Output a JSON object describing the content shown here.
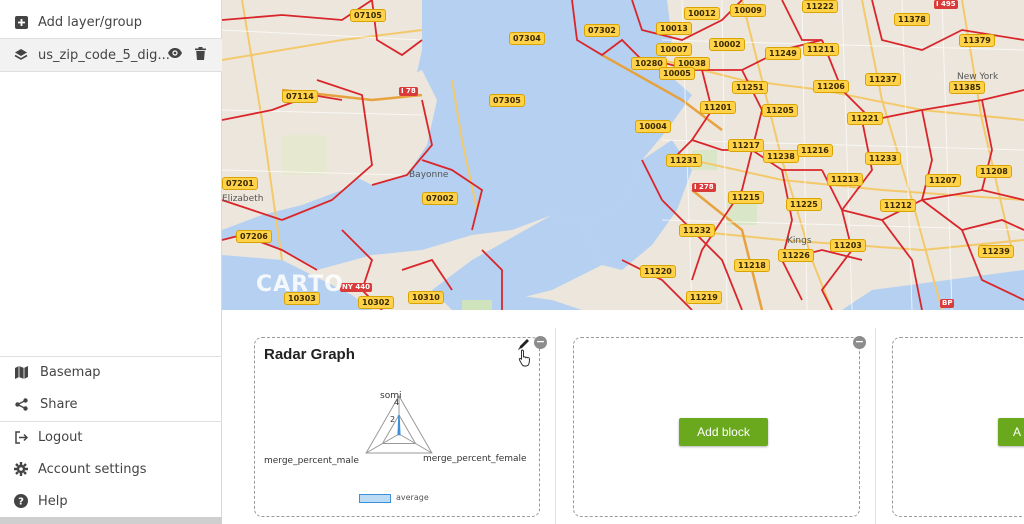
{
  "sidebar": {
    "add_layer_label": "Add layer/group",
    "layer_name": "us_zip_code_5_dig...",
    "bottom_items": [
      {
        "label": "Basemap",
        "icon": "map-icon"
      },
      {
        "label": "Share",
        "icon": "share-icon"
      },
      {
        "label": "Logout",
        "icon": "logout-icon"
      },
      {
        "label": "Account settings",
        "icon": "gear-icon"
      },
      {
        "label": "Help",
        "icon": "help-icon"
      }
    ]
  },
  "map": {
    "zip_labels": [
      "07105",
      "07304",
      "07302",
      "10013",
      "10012",
      "10009",
      "11222",
      "11378",
      "11379",
      "10007",
      "10002",
      "11249",
      "11211",
      "10280",
      "10038",
      "10005",
      "07114",
      "07305",
      "11251",
      "11206",
      "11237",
      "11385",
      "11201",
      "11205",
      "11221",
      "10004",
      "11217",
      "11238",
      "11216",
      "11233",
      "11231",
      "11213",
      "11207",
      "11208",
      "07201",
      "07002",
      "11215",
      "11225",
      "11212",
      "07206",
      "11232",
      "11203",
      "11239",
      "11226",
      "11218",
      "11220",
      "11219",
      "10303",
      "10302",
      "10310"
    ],
    "place_labels": [
      "Bayonne",
      "Elizabeth",
      "Kings",
      "New York"
    ],
    "road_shields": [
      "I 78",
      "I 278",
      "NY 440",
      "I 495",
      "BP"
    ],
    "watermark": "CARTO"
  },
  "blocks": {
    "radar": {
      "title": "Radar Graph",
      "axes": [
        "somi",
        "merge_percent_male",
        "merge_percent_female"
      ],
      "ticks": [
        "4",
        "2"
      ],
      "legend": "average",
      "values": [
        2,
        0.1,
        0.1
      ],
      "max": 4
    },
    "add_block_label": "Add block",
    "add_block_label_partial": "A"
  },
  "colors": {
    "accent_green": "#6aa91e",
    "zip_label": "#ffd24a",
    "boundary_red": "#d9262b",
    "water": "#b5d0f0",
    "radar_fill": "#bcdcf5"
  }
}
